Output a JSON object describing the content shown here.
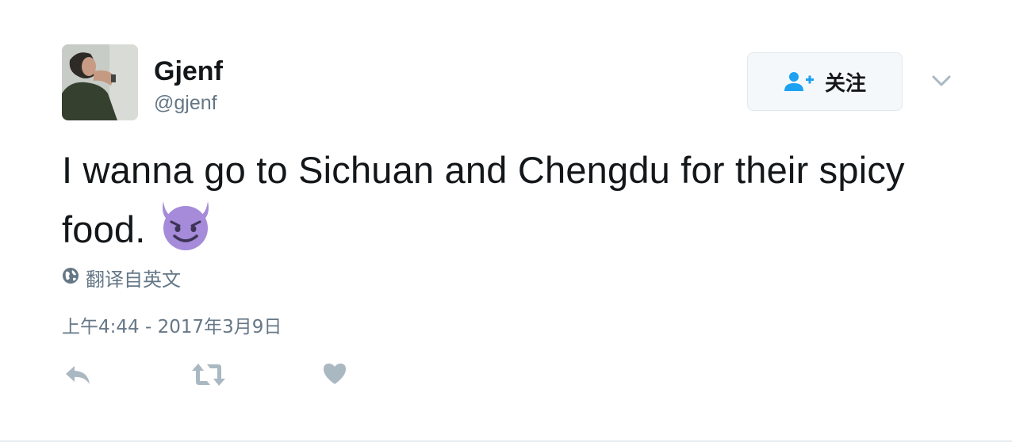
{
  "tweet": {
    "author": {
      "display_name": "Gjenf",
      "screen_name": "@gjenf"
    },
    "follow_button": {
      "label": "关注",
      "icon": "add-user-icon"
    },
    "menu_icon": "chevron-down-icon",
    "text": "I wanna go to Sichuan and Chengdu for their spicy food.",
    "emoji": "smiling-face-with-horns",
    "translate": {
      "label": "翻译自英文",
      "icon": "globe-icon"
    },
    "timestamp": "上午4:44 - 2017年3月9日",
    "actions": [
      "reply-icon",
      "retweet-icon",
      "like-icon"
    ]
  },
  "colors": {
    "text": "#14171a",
    "secondary": "#657786",
    "accent": "#1da1f2",
    "action_gray": "#aab8c2",
    "emoji_purple": "#a58bd9"
  }
}
